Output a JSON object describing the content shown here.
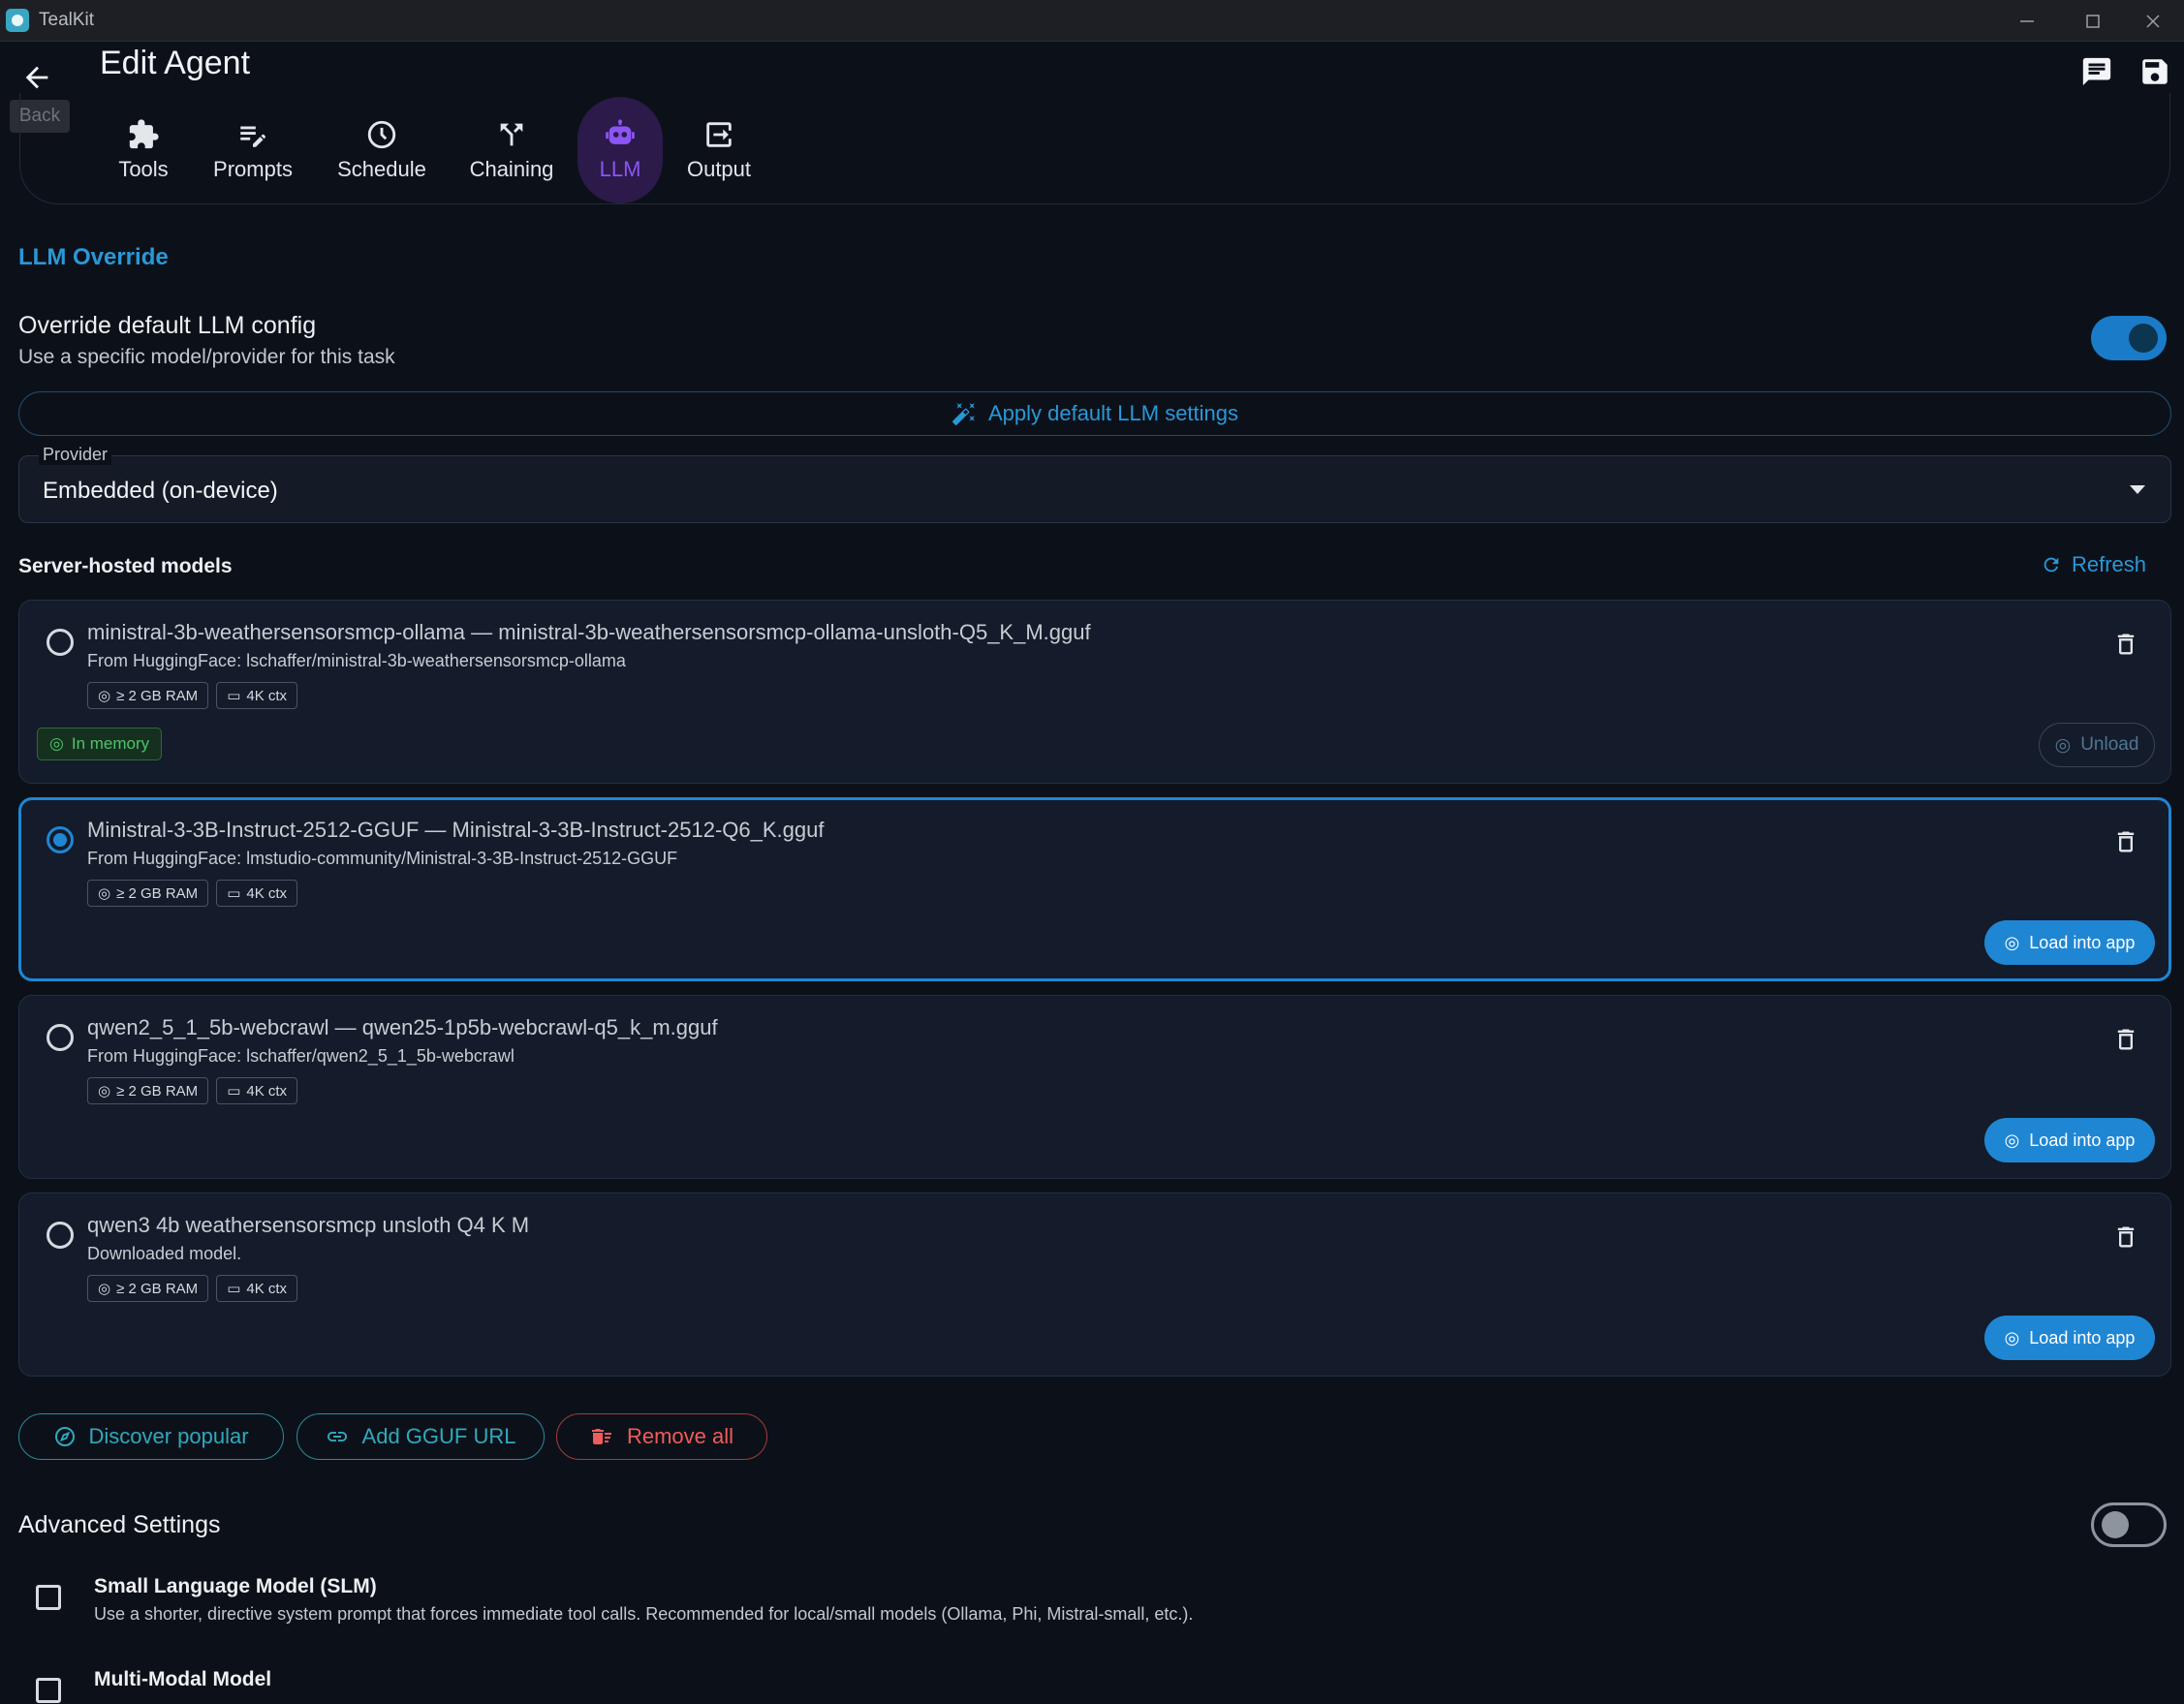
{
  "window": {
    "app_name": "TealKit"
  },
  "header": {
    "title": "Edit Agent",
    "back_tooltip": "Back"
  },
  "tabs": [
    {
      "label": "Tools",
      "icon": "puzzle-icon"
    },
    {
      "label": "Prompts",
      "icon": "edit-note-icon"
    },
    {
      "label": "Schedule",
      "icon": "clock-icon"
    },
    {
      "label": "Chaining",
      "icon": "fork-icon"
    },
    {
      "label": "LLM",
      "icon": "robot-icon",
      "active": true
    },
    {
      "label": "Output",
      "icon": "export-icon"
    }
  ],
  "llm_override": {
    "section_title": "LLM Override",
    "override_title": "Override default LLM config",
    "override_subtitle": "Use a specific model/provider for this task",
    "override_enabled": true,
    "apply_default_label": "Apply default LLM settings",
    "provider_label": "Provider",
    "provider_value": "Embedded (on-device)"
  },
  "models_section": {
    "heading": "Server-hosted models",
    "refresh_label": "Refresh",
    "models": [
      {
        "name": "ministral-3b-weathersensorsmcp-ollama — ministral-3b-weathersensorsmcp-ollama-unsloth-Q5_K_M.gguf",
        "source": "From HuggingFace: lschaffer/ministral-3b-weathersensorsmcp-ollama",
        "ram": "≥ 2 GB RAM",
        "ctx": "4K ctx",
        "selected": false,
        "status": "In memory",
        "action": "Unload"
      },
      {
        "name": "Ministral-3-3B-Instruct-2512-GGUF — Ministral-3-3B-Instruct-2512-Q6_K.gguf",
        "source": "From HuggingFace: lmstudio-community/Ministral-3-3B-Instruct-2512-GGUF",
        "ram": "≥ 2 GB RAM",
        "ctx": "4K ctx",
        "selected": true,
        "action": "Load into app"
      },
      {
        "name": "qwen2_5_1_5b-webcrawl — qwen25-1p5b-webcrawl-q5_k_m.gguf",
        "source": "From HuggingFace: lschaffer/qwen2_5_1_5b-webcrawl",
        "ram": "≥ 2 GB RAM",
        "ctx": "4K ctx",
        "selected": false,
        "action": "Load into app"
      },
      {
        "name": "qwen3 4b weathersensorsmcp unsloth Q4 K M",
        "source": "Downloaded model.",
        "ram": "≥ 2 GB RAM",
        "ctx": "4K ctx",
        "selected": false,
        "action": "Load into app"
      }
    ],
    "buttons": {
      "discover": "Discover popular",
      "add_url": "Add GGUF URL",
      "remove_all": "Remove all"
    }
  },
  "advanced": {
    "title": "Advanced Settings",
    "enabled": false,
    "options": [
      {
        "title": "Small Language Model (SLM)",
        "description": "Use a shorter, directive system prompt that forces immediate tool calls. Recommended for local/small models (Ollama, Phi, Mistral-small, etc.)."
      },
      {
        "title": "Multi-Modal Model",
        "description": ""
      }
    ]
  },
  "colors": {
    "accent_blue": "#1f86d4",
    "accent_purple": "#8b55f5",
    "teal": "#30a9bc",
    "danger": "#f05b5b",
    "success": "#4fc26a",
    "background": "#0c1119"
  }
}
